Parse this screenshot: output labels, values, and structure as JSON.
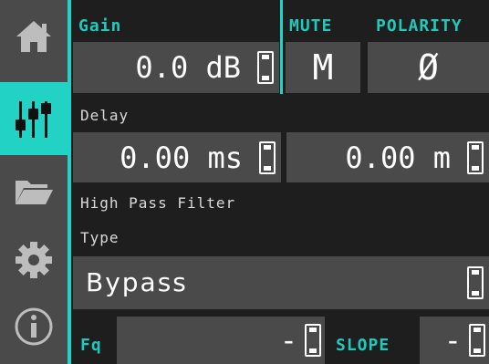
{
  "sidebar": {
    "items": [
      {
        "name": "home",
        "icon": "home-icon"
      },
      {
        "name": "mixer",
        "icon": "sliders-icon",
        "active": true
      },
      {
        "name": "files",
        "icon": "folder-icon"
      },
      {
        "name": "settings",
        "icon": "gear-icon"
      },
      {
        "name": "info",
        "icon": "info-icon"
      }
    ]
  },
  "gain": {
    "label": "Gain",
    "value": "0.0 dB"
  },
  "mute": {
    "label": "MUTE",
    "value": "M"
  },
  "polarity": {
    "label": "POLARITY",
    "value": "Ø"
  },
  "delay": {
    "label": "Delay",
    "ms_value": "0.00 ms",
    "m_value": "0.00 m"
  },
  "highpass": {
    "label": "High Pass Filter",
    "type_label": "Type",
    "type_value": "Bypass"
  },
  "freq": {
    "label": "Fq",
    "value": "-"
  },
  "slope": {
    "label": "SLOPE",
    "value": "-"
  },
  "colors": {
    "accent": "#22d3c5",
    "field": "#4a4a4a",
    "background": "#1e1e1e"
  }
}
